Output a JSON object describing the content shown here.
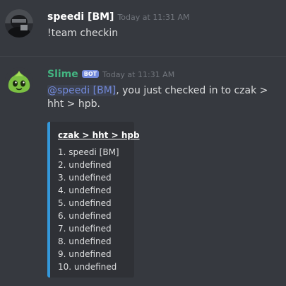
{
  "messages": [
    {
      "author": "speedi [BM]",
      "timestamp": "Today at 11:31 AM",
      "avatar_icon": "user-avatar-dark",
      "content": "!team checkin"
    },
    {
      "author": "Slime",
      "bot_tag": "BOT",
      "timestamp": "Today at 11:31 AM",
      "avatar_icon": "green-slime-avatar",
      "mention": "@speedi [BM]",
      "content": ", you just checked in to czak > hht > hpb.",
      "embed": {
        "title": "czak > hht > hpb",
        "accent_color": "#3498db",
        "lines": [
          "1. speedi [BM]",
          "2. undefined",
          "3. undefined",
          "4. undefined",
          "5. undefined",
          "6. undefined",
          "7. undefined",
          "8. undefined",
          "9. undefined",
          "10. undefined"
        ]
      }
    }
  ],
  "colors": {
    "background": "#36393f",
    "bot_name": "#43b581",
    "bot_tag": "#7289da",
    "mention": "#7289da",
    "embed_background": "#2f3136"
  }
}
